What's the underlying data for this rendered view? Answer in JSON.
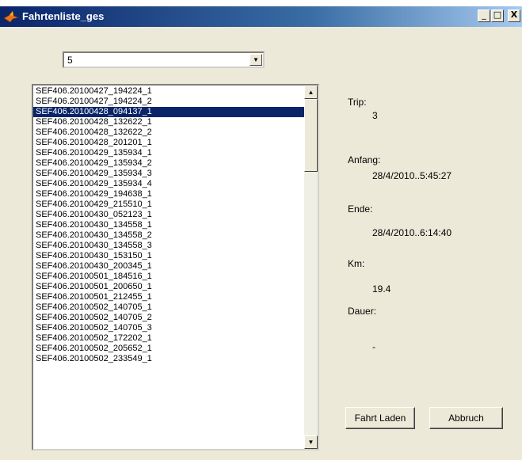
{
  "window": {
    "title": "Fahrtenliste_ges",
    "controls": {
      "minimize": "_",
      "maximize": "□",
      "close": "X"
    }
  },
  "combo": {
    "value": "5",
    "icon": "chevron-down-icon"
  },
  "list": {
    "selected_index": 2,
    "items": [
      "SEF406.20100427_194224_1",
      "SEF406.20100427_194224_2",
      "SEF406.20100428_094137_1",
      "SEF406.20100428_132622_1",
      "SEF406.20100428_132622_2",
      "SEF406.20100428_201201_1",
      "SEF406.20100429_135934_1",
      "SEF406.20100429_135934_2",
      "SEF406.20100429_135934_3",
      "SEF406.20100429_135934_4",
      "SEF406.20100429_194638_1",
      "SEF406.20100429_215510_1",
      "SEF406.20100430_052123_1",
      "SEF406.20100430_134558_1",
      "SEF406.20100430_134558_2",
      "SEF406.20100430_134558_3",
      "SEF406.20100430_153150_1",
      "SEF406.20100430_200345_1",
      "SEF406.20100501_184516_1",
      "SEF406.20100501_200650_1",
      "SEF406.20100501_212455_1",
      "SEF406.20100502_140705_1",
      "SEF406.20100502_140705_2",
      "SEF406.20100502_140705_3",
      "SEF406.20100502_172202_1",
      "SEF406.20100502_205652_1",
      "SEF406.20100502_233549_1"
    ]
  },
  "info": {
    "trip_label": "Trip:",
    "trip_value": "3",
    "anfang_label": "Anfang:",
    "anfang_value": "28/4/2010..5:45:27",
    "ende_label": "Ende:",
    "ende_value": "28/4/2010..6:14:40",
    "km_label": "Km:",
    "km_value": "19.4",
    "dauer_label": "Dauer:",
    "dauer_value": "-"
  },
  "buttons": {
    "load": "Fahrt Laden",
    "cancel": "Abbruch"
  },
  "colors": {
    "selection": "#0a246a",
    "face": "#ece9d8",
    "title_bar": "#0a246a"
  }
}
